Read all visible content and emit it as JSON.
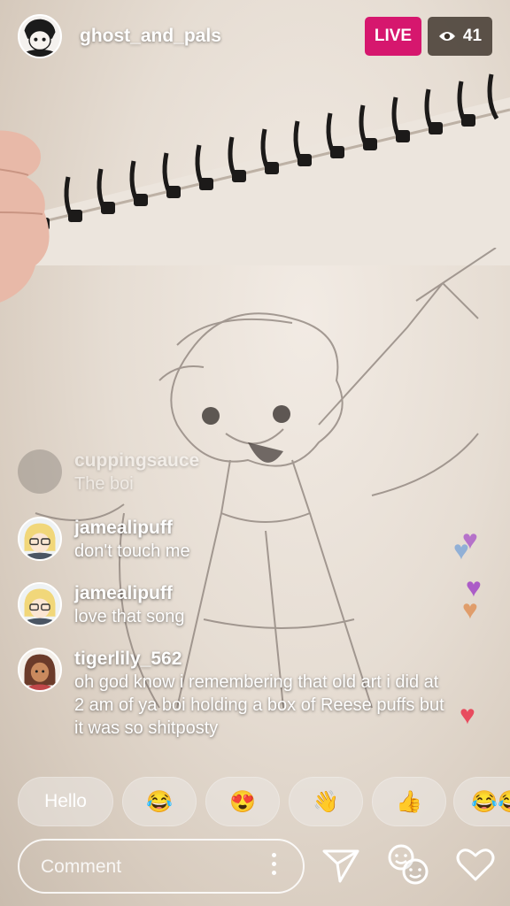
{
  "header": {
    "username": "ghost_and_pals",
    "live_label": "LIVE",
    "viewer_count": "41"
  },
  "comments": [
    {
      "user": "cuppingsauce",
      "text": "The boi",
      "faded": true
    },
    {
      "user": "jamealipuff",
      "text": "don't touch me"
    },
    {
      "user": "jamealipuff",
      "text": "love that song"
    },
    {
      "user": "tigerlily_562",
      "text": "oh god know i remembering that old art i did at 2 am of ya boi holding a box of Reese puffs but it was so shitposty"
    }
  ],
  "quick_replies": [
    "Hello",
    "😂",
    "😍",
    "👋",
    "👍",
    "😂😂"
  ],
  "composer": {
    "placeholder": "Comment"
  },
  "icons": {
    "viewer": "eye-icon",
    "more": "more-vertical-icon",
    "send": "send-icon",
    "faces": "face-filter-icon",
    "like": "heart-icon"
  },
  "colors": {
    "live": "#d6176e",
    "viewer_badge": "#3c322a",
    "heart_purple": "#a64fc7",
    "heart_blue": "#6e9ed8",
    "heart_orange": "#e0935a",
    "heart_red": "#e84b5e"
  }
}
